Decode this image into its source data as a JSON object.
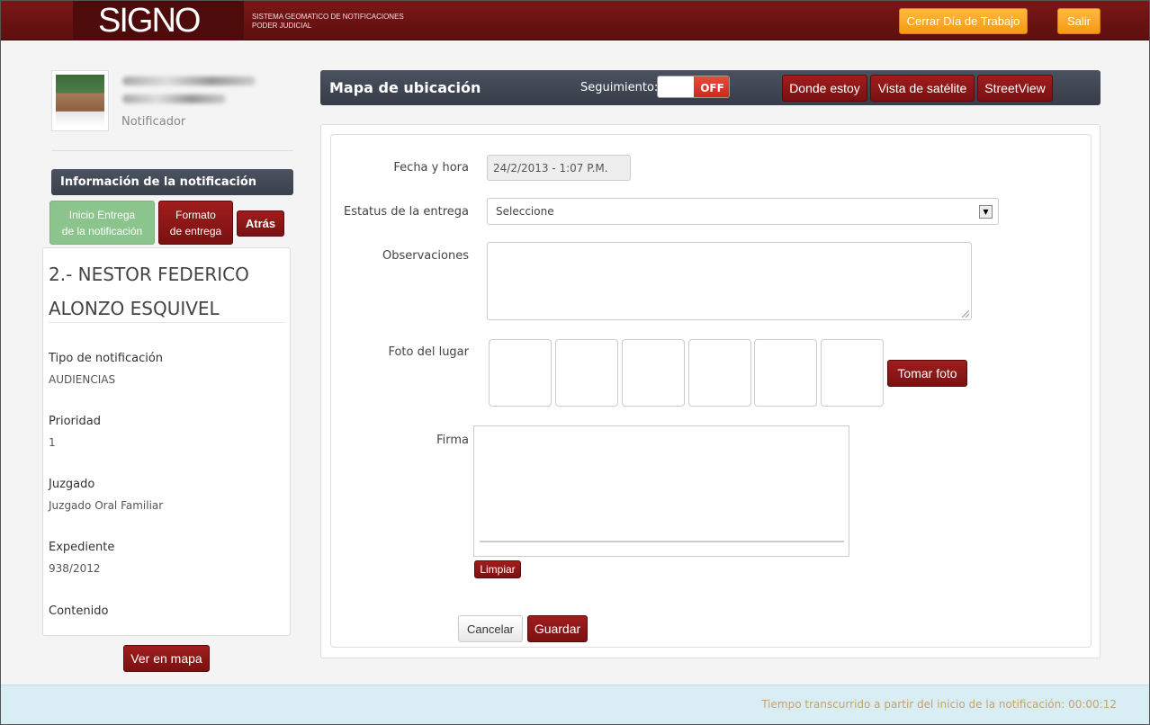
{
  "header": {
    "logo": "SIGNO",
    "system_line1": "SISTEMA GEOMATICO DE NOTIFICACIONES",
    "system_line2": "PODER JUDICIAL",
    "close_day_label": "Cerrar Día de Trabajo",
    "exit_label": "Salir"
  },
  "user": {
    "role": "Notificador"
  },
  "sidebar": {
    "info_title": "Información de la notificación",
    "tab_start_line1": "Inicio Entrega",
    "tab_start_line2": "de la notificación",
    "tab_format_line1": "Formato",
    "tab_format_line2": "de entrega",
    "back_label": "Atrás",
    "person_name": "2.- NESTOR FEDERICO ALONZO ESQUIVEL",
    "fields": [
      {
        "label": "Tipo de notificación",
        "value": "AUDIENCIAS"
      },
      {
        "label": "Prioridad",
        "value": "1"
      },
      {
        "label": "Juzgado",
        "value": "Juzgado Oral Familiar"
      },
      {
        "label": "Expediente",
        "value": "938/2012"
      },
      {
        "label": "Contenido",
        "value": ""
      }
    ],
    "map_button": "Ver en mapa"
  },
  "mapbar": {
    "title": "Mapa de ubicación",
    "tracking_label": "Seguimiento:",
    "toggle_state": "OFF",
    "btn_where": "Donde estoy",
    "btn_satellite": "Vista de satélite",
    "btn_street": "StreetView"
  },
  "form": {
    "datetime_label": "Fecha y hora",
    "datetime_value": "24/2/2013 - 1:07  P.M.",
    "status_label": "Estatus de la entrega",
    "status_value": "Seleccione",
    "obs_label": "Observaciones",
    "photo_label": "Foto del lugar",
    "take_photo": "Tomar foto",
    "signature_label": "Firma",
    "clear_label": "Limpiar",
    "cancel_label": "Cancelar",
    "save_label": "Guardar"
  },
  "footer": {
    "elapsed": "Tiempo transcurrido a partir del inicio de la notificación: 00:00:12"
  },
  "colors": {
    "header_red": "#6b1313",
    "orange": "#f7a11f",
    "dark_red_button": "#8b1616",
    "green_tab": "#8cc48e",
    "footer_blue": "#d9edf5"
  }
}
